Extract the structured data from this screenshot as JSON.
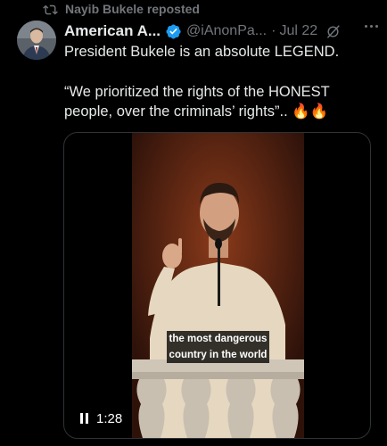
{
  "repost": {
    "label": "Nayib Bukele reposted",
    "icon": "repost-icon"
  },
  "author": {
    "display_name": "American A...",
    "handle": "@iAnonPa...",
    "separator": "·",
    "date": "Jul 22",
    "verified_icon": "verified-badge-icon",
    "verified_color": "#1d9bf0"
  },
  "tweet": {
    "line1": "President Bukele is an absolute LEGEND.",
    "line2": "“We prioritized the rights of the HONEST",
    "line3": "people, over the criminals’ rights”.. 🔥🔥"
  },
  "video": {
    "caption_line1": "the most dangerous",
    "caption_line2": "country in the world",
    "time": "1:28",
    "state": "playing"
  },
  "colors": {
    "background": "#000000",
    "text": "#e7e9ea",
    "secondary": "#71767b",
    "border": "#2f3336"
  }
}
